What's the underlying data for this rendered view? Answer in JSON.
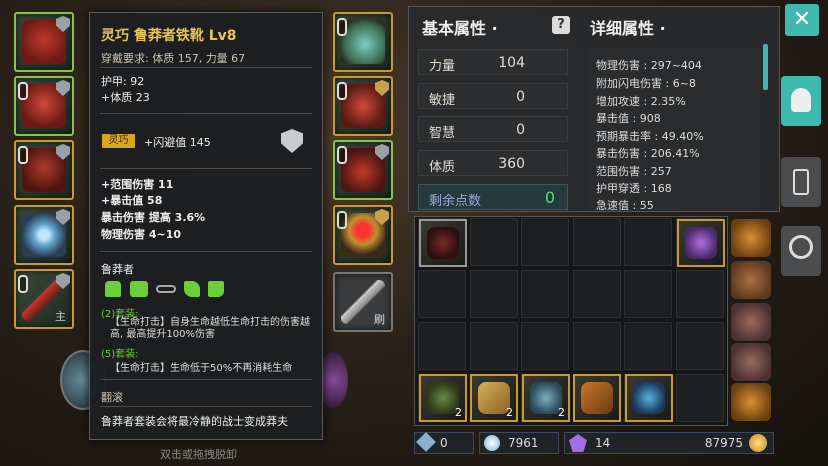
{
  "tooltip": {
    "title": "灵巧  鲁莽者铁靴  Lv8",
    "requirement": "穿戴要求:  体质 157, 力量 67",
    "base_stats": [
      "护甲:  92",
      "+体质  23"
    ],
    "affix_tag": "灵巧",
    "affix_text": "+闪避值  145",
    "extra_stats": [
      "+范围伤害  11",
      "+暴击值  58",
      "暴击伤害  提高  3.6%",
      "物理伤害  4~10"
    ],
    "set_name": "鲁莽者",
    "set_bonus_2_title": "(2)套装:",
    "set_bonus_2_text": "【生命打击】自身生命越低生命打击的伤害越高,  最高提升100%伤害",
    "set_bonus_5_title": "(5)套装:",
    "set_bonus_5_text": "【生命打击】生命低于50%不再消耗生命",
    "skill_name": "翻滚",
    "flavor": "鲁莽者套装会将最冷静的战士变成莽夫"
  },
  "hint_text": "双击或拖拽脱卸",
  "weapon_slot_label": "刷",
  "ring_slot_label": "主",
  "basic_attr": {
    "title": "基本属性 ·",
    "rows": [
      {
        "label": "力量",
        "value": "104"
      },
      {
        "label": "敏捷",
        "value": "0"
      },
      {
        "label": "智慧",
        "value": "0"
      },
      {
        "label": "体质",
        "value": "360"
      }
    ],
    "points_label": "剩余点数",
    "points_value": "0"
  },
  "detail_attr": {
    "title": "详细属性 ·",
    "lines": [
      "物理伤害 : 297~404",
      "附加闪电伤害 : 6~8",
      "增加攻速 : 2.35%",
      "暴击值 : 908",
      "预期暴击率 : 49.40%",
      "暴击伤害 : 206.41%",
      "范围伤害 : 257",
      "护甲穿透 : 168",
      "急速值 : 55"
    ]
  },
  "inventory": {
    "counts": [
      "2",
      "2",
      "2"
    ]
  },
  "currency": {
    "crystals": "0",
    "souls": "7961",
    "gems": "14",
    "gold": "87975"
  },
  "colors": {
    "title_gold": "#e8c35a",
    "set_green": "#6ccf3a",
    "points_green": "#4ee07a",
    "accent_teal": "#3fb8b0"
  }
}
